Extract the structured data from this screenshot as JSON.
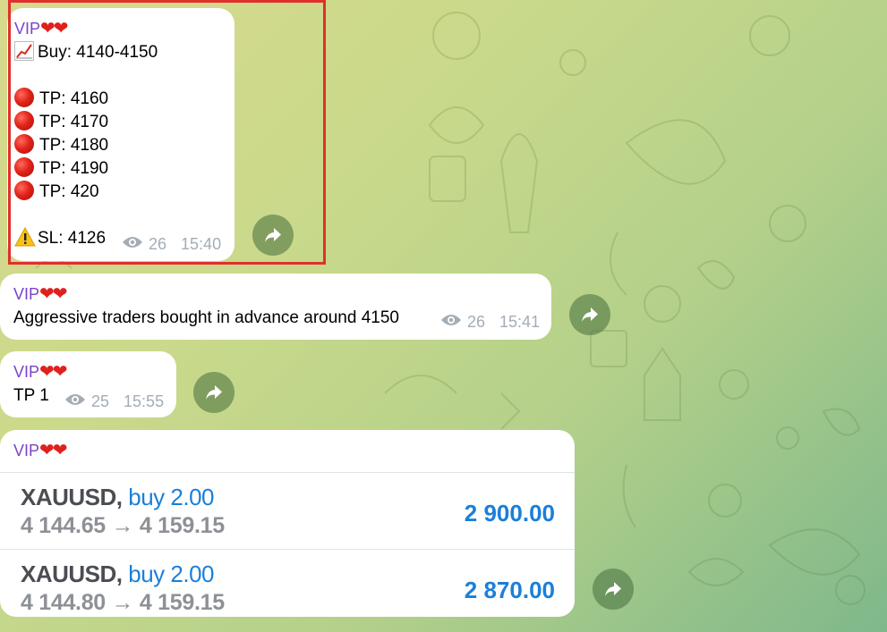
{
  "messages": [
    {
      "sender": "VIP",
      "hearts": "❤❤",
      "buy": "Buy: 4140-4150",
      "tps": [
        "TP: 4160",
        "TP: 4170",
        "TP: 4180",
        "TP: 4190",
        "TP: 420"
      ],
      "sl": "SL: 4126",
      "views": "26",
      "time": "15:40"
    },
    {
      "sender": "VIP",
      "hearts": "❤❤",
      "text": "Aggressive traders bought in advance around 4150",
      "views": "26",
      "time": "15:41"
    },
    {
      "sender": "VIP",
      "hearts": "❤❤",
      "text": "TP 1",
      "views": "25",
      "time": "15:55"
    },
    {
      "sender": "VIP",
      "hearts": "❤❤",
      "trades": [
        {
          "symbol": "XAUUSD,",
          "side": "buy 2.00",
          "price": "4 144.65 → 4 159.15",
          "profit": "2 900.00"
        },
        {
          "symbol": "XAUUSD,",
          "side": "buy 2.00",
          "price": "4 144.80 → 4 159.15",
          "profit": "2 870.00"
        }
      ]
    }
  ],
  "icons": {
    "forward": "share-arrow-icon",
    "views": "eye-icon"
  },
  "colors": {
    "sender": "#7a44c7",
    "accent": "#1b7fd8",
    "highlight": "#e0302b"
  }
}
